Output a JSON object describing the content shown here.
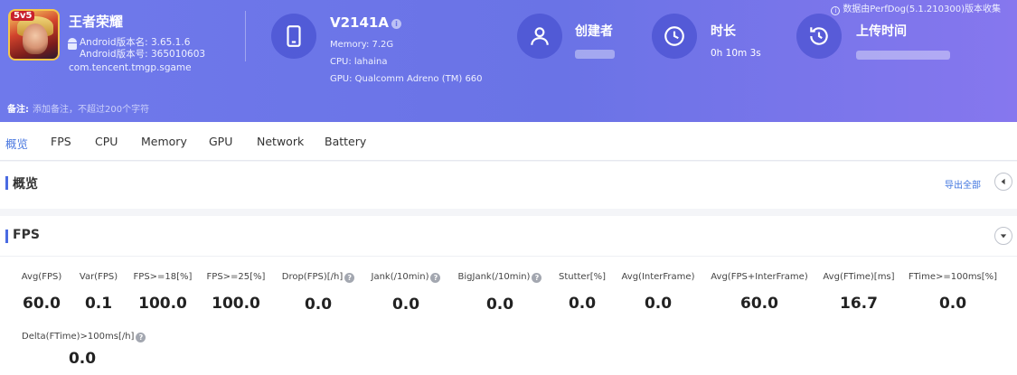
{
  "header": {
    "notice": "数据由PerfDog(5.1.210300)版本收集",
    "app": {
      "icon_badge": "5v5",
      "name": "王者荣耀",
      "version_name": "Android版本名: 3.65.1.6",
      "version_code": "Android版本号: 365010603",
      "package": "com.tencent.tmgp.sgame"
    },
    "device": {
      "name": "V2141A",
      "info_icon": "i",
      "memory": "Memory: 7.2G",
      "cpu": "CPU: lahaina",
      "gpu": "GPU: Qualcomm Adreno (TM) 660"
    },
    "creator": {
      "title": "创建者"
    },
    "duration": {
      "title": "时长",
      "value": "0h 10m 3s"
    },
    "upload": {
      "title": "上传时间"
    },
    "remark": {
      "label": "备注:",
      "placeholder": "添加备注，不超过200个字符"
    }
  },
  "tabs": [
    {
      "label": "概览",
      "active": true
    },
    {
      "label": "FPS"
    },
    {
      "label": "CPU"
    },
    {
      "label": "Memory"
    },
    {
      "label": "GPU"
    },
    {
      "label": "Network"
    },
    {
      "label": "Battery"
    }
  ],
  "overview": {
    "title": "概览",
    "export_label": "导出全部"
  },
  "fps": {
    "title": "FPS",
    "metrics": [
      {
        "label": "Avg(FPS)",
        "value": "60.0"
      },
      {
        "label": "Var(FPS)",
        "value": "0.1"
      },
      {
        "label": "FPS>=18[%]",
        "value": "100.0"
      },
      {
        "label": "FPS>=25[%]",
        "value": "100.0"
      },
      {
        "label": "Drop(FPS)[/h]",
        "value": "0.0",
        "help": "?"
      },
      {
        "label": "Jank(/10min)",
        "value": "0.0",
        "help": "?"
      },
      {
        "label": "BigJank(/10min)",
        "value": "0.0",
        "help": "?"
      },
      {
        "label": "Stutter[%]",
        "value": "0.0"
      },
      {
        "label": "Avg(InterFrame)",
        "value": "0.0"
      },
      {
        "label": "Avg(FPS+InterFrame)",
        "value": "60.0"
      },
      {
        "label": "Avg(FTime)[ms]",
        "value": "16.7"
      },
      {
        "label": "FTime>=100ms[%]",
        "value": "0.0"
      },
      {
        "label": "Delta(FTime)>100ms[/h]",
        "value": "0.0",
        "help": "?"
      }
    ]
  },
  "colors": {
    "header_gradient_start": "#6f79eb",
    "header_gradient_end": "#8677ee",
    "accent": "#4a6be2",
    "active_tab": "#4a78e0"
  },
  "icons": [
    "android-icon",
    "phone-icon",
    "info-icon",
    "user-icon",
    "clock-icon",
    "history-icon",
    "collapse-left-icon",
    "expand-down-icon",
    "help-icon"
  ]
}
